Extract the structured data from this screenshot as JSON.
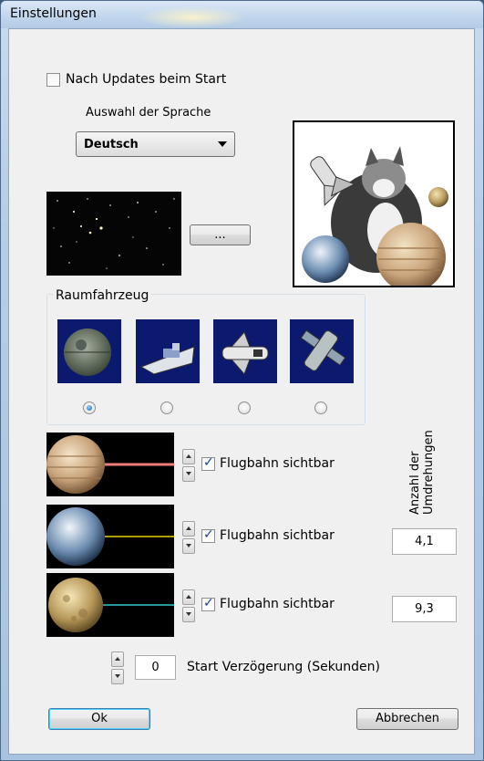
{
  "window": {
    "title": "Einstellungen"
  },
  "updates": {
    "label": "Nach Updates beim Start",
    "checked": false
  },
  "language": {
    "label": "Auswahl der Sprache",
    "selected": "Deutsch"
  },
  "background": {
    "browse_label": "..."
  },
  "spacecraft": {
    "group_label": "Raumfahrzeug",
    "options": [
      {
        "name": "death-star",
        "selected": true
      },
      {
        "name": "star-destroyer",
        "selected": false
      },
      {
        "name": "space-shuttle",
        "selected": false
      },
      {
        "name": "satellite",
        "selected": false
      }
    ]
  },
  "rotations": {
    "label": "Anzahl der Umdrehungen"
  },
  "orbits": [
    {
      "planet": "jupiter",
      "visible_label": "Flugbahn sichtbar",
      "checked": true,
      "line_color": "#f07c7c",
      "rotations": ""
    },
    {
      "planet": "earth",
      "visible_label": "Flugbahn sichtbar",
      "checked": true,
      "line_color": "#e6d400",
      "rotations": "4,1"
    },
    {
      "planet": "moon",
      "visible_label": "Flugbahn sichtbar",
      "checked": true,
      "line_color": "#36c6d0",
      "rotations": "9,3"
    }
  ],
  "start_delay": {
    "value": "0",
    "label": "Start Verzögerung (Sekunden)"
  },
  "buttons": {
    "ok": "Ok",
    "cancel": "Abbrechen"
  }
}
